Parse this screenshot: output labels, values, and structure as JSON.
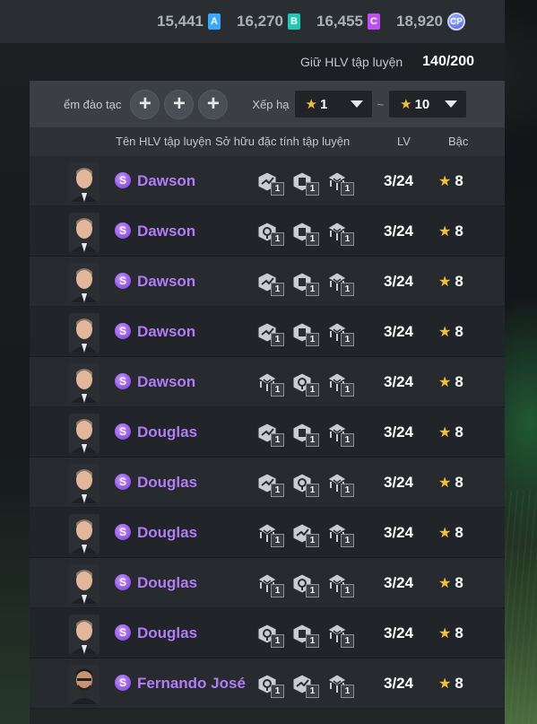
{
  "currencies": [
    {
      "value": "15,441",
      "badge": "A",
      "color": "#3aa6ff"
    },
    {
      "value": "16,270",
      "badge": "B",
      "color": "#21c6b6"
    },
    {
      "value": "16,455",
      "badge": "C",
      "color": "#c04df0"
    },
    {
      "value": "18,920",
      "badge": "CP",
      "color": "#6a7df0"
    }
  ],
  "info": {
    "label": "Giữ HLV tập luyện",
    "value": "140/200"
  },
  "filter": {
    "label_left": "ểm đào tạc",
    "label_sort": "Xếp hạ",
    "sel_min_star": "★",
    "sel_min": "1",
    "tilde": "~",
    "sel_max_star": "★",
    "sel_max": "10"
  },
  "columns": {
    "name": "Tên HLV tập luyện",
    "traits": "Sở hữu đặc tính tập luyện",
    "lv": "LV",
    "rank": "Bậc"
  },
  "rows": [
    {
      "grade": "S",
      "name": "Dawson",
      "traits": [
        "1",
        "1",
        "1"
      ],
      "lv": "3/24",
      "rank": "8",
      "icons": [
        "whistle-icon",
        "card-icon",
        "tactic-icon"
      ]
    },
    {
      "grade": "S",
      "name": "Dawson",
      "traits": [
        "1",
        "1",
        "1"
      ],
      "lv": "3/24",
      "rank": "8",
      "icons": [
        "shield-icon",
        "card-icon",
        "tactic-icon"
      ]
    },
    {
      "grade": "S",
      "name": "Dawson",
      "traits": [
        "1",
        "1",
        "1"
      ],
      "lv": "3/24",
      "rank": "8",
      "icons": [
        "whistle-icon",
        "card-icon",
        "tactic-icon"
      ]
    },
    {
      "grade": "S",
      "name": "Dawson",
      "traits": [
        "1",
        "1",
        "1"
      ],
      "lv": "3/24",
      "rank": "8",
      "icons": [
        "whistle-icon",
        "card-icon",
        "tactic-icon"
      ]
    },
    {
      "grade": "S",
      "name": "Dawson",
      "traits": [
        "1",
        "1",
        "1"
      ],
      "lv": "3/24",
      "rank": "8",
      "icons": [
        "tactic-icon",
        "shield-icon",
        "tactic-icon"
      ]
    },
    {
      "grade": "S",
      "name": "Douglas",
      "traits": [
        "1",
        "1",
        "1"
      ],
      "lv": "3/24",
      "rank": "8",
      "icons": [
        "whistle-icon",
        "card-icon",
        "tactic-icon"
      ]
    },
    {
      "grade": "S",
      "name": "Douglas",
      "traits": [
        "1",
        "1",
        "1"
      ],
      "lv": "3/24",
      "rank": "8",
      "icons": [
        "whistle-icon",
        "shield-icon",
        "tactic-icon"
      ]
    },
    {
      "grade": "S",
      "name": "Douglas",
      "traits": [
        "1",
        "1",
        "1"
      ],
      "lv": "3/24",
      "rank": "8",
      "icons": [
        "tactic-icon",
        "whistle-icon",
        "tactic-icon"
      ]
    },
    {
      "grade": "S",
      "name": "Douglas",
      "traits": [
        "1",
        "1",
        "1"
      ],
      "lv": "3/24",
      "rank": "8",
      "icons": [
        "tactic-icon",
        "shield-icon",
        "tactic-icon"
      ]
    },
    {
      "grade": "S",
      "name": "Douglas",
      "traits": [
        "1",
        "1",
        "1"
      ],
      "lv": "3/24",
      "rank": "8",
      "icons": [
        "shield-icon",
        "card-icon",
        "tactic-icon"
      ]
    },
    {
      "grade": "S",
      "name": "Fernando José",
      "traits": [
        "1",
        "1",
        "1"
      ],
      "lv": "3/24",
      "rank": "8",
      "icons": [
        "shield-icon",
        "whistle-icon",
        "tactic-icon"
      ]
    }
  ]
}
